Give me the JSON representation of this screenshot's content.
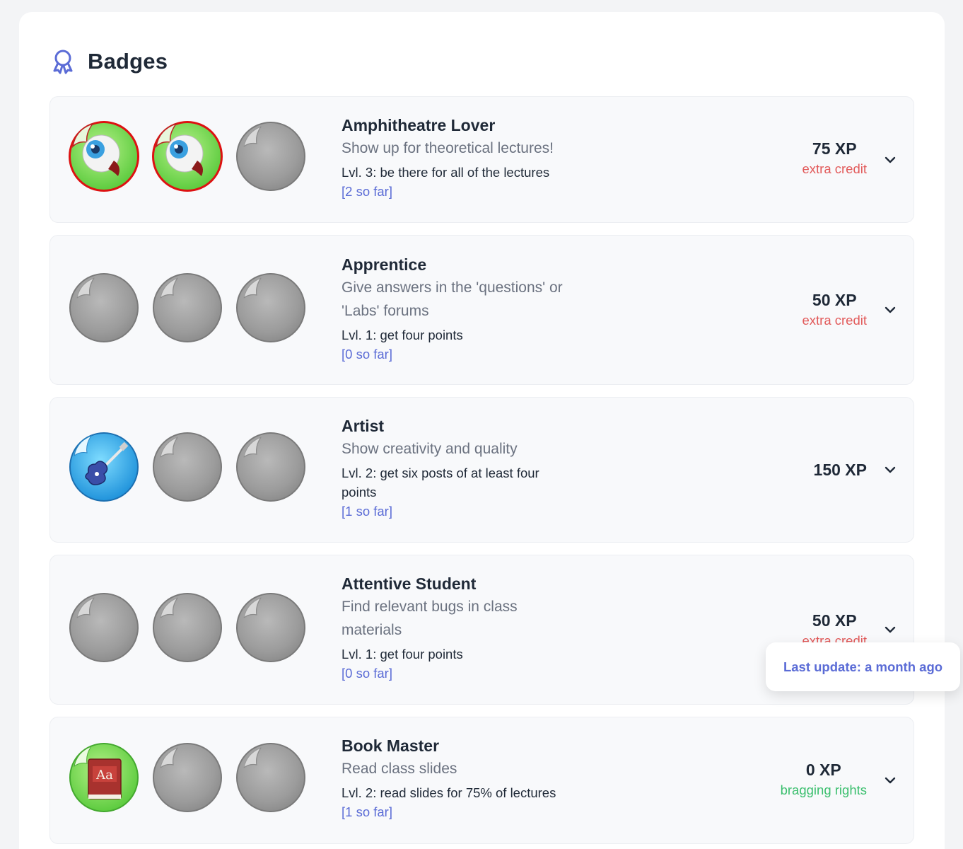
{
  "section": {
    "title": "Badges",
    "icon": "award-ribbon-icon"
  },
  "badges": [
    {
      "name": "Amphitheatre Lover",
      "description": "Show up for theoretical lectures!",
      "level_text": "Lvl. 3: be there for all of the lectures",
      "progress": "[2 so far]",
      "xp": "75 XP",
      "tag": "extra credit",
      "medals": [
        "eyeball-medal-icon",
        "eyeball-medal-icon",
        "locked-medal-icon"
      ]
    },
    {
      "name": "Apprentice",
      "description": "Give answers in the 'questions' or 'Labs' forums",
      "level_text": "Lvl. 1: get four points",
      "progress": "[0 so far]",
      "xp": "50 XP",
      "tag": "extra credit",
      "medals": [
        "locked-medal-icon",
        "locked-medal-icon",
        "locked-medal-icon"
      ]
    },
    {
      "name": "Artist",
      "description": "Show creativity and quality",
      "level_text": "Lvl. 2: get six posts of at least four points",
      "progress": "[1 so far]",
      "xp": "150 XP",
      "tag": "",
      "medals": [
        "guitar-medal-icon",
        "locked-medal-icon",
        "locked-medal-icon"
      ]
    },
    {
      "name": "Attentive Student",
      "description": "Find relevant bugs in class materials",
      "level_text": "Lvl. 1: get four points",
      "progress": "[0 so far]",
      "xp": "50 XP",
      "tag": "extra credit",
      "medals": [
        "locked-medal-icon",
        "locked-medal-icon",
        "locked-medal-icon"
      ]
    },
    {
      "name": "Book Master",
      "description": "Read class slides",
      "level_text": "Lvl. 2: read slides for 75% of lectures",
      "progress": "[1 so far]",
      "xp": "0 XP",
      "tag": "bragging rights",
      "medals": [
        "book-medal-icon",
        "locked-medal-icon",
        "locked-medal-icon"
      ]
    }
  ],
  "tooltip": {
    "text": "Last update: a month ago"
  },
  "colors": {
    "accent": "#5b6cd6",
    "extra_credit": "#e25a5a",
    "bragging_rights": "#3bbf6e"
  }
}
